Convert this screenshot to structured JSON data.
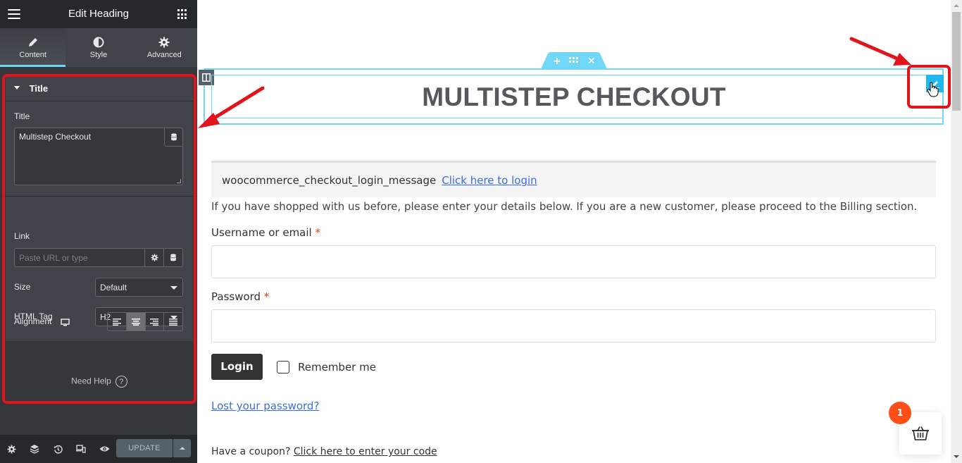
{
  "sidebar": {
    "header": {
      "title": "Edit Heading",
      "menu_icon": "hamburger-icon",
      "apps_icon": "grid-icon"
    },
    "tabs": [
      {
        "label": "Content",
        "icon": "pencil-icon",
        "active": true
      },
      {
        "label": "Style",
        "icon": "half-circle-icon",
        "active": false
      },
      {
        "label": "Advanced",
        "icon": "gear-icon",
        "active": false
      }
    ],
    "section": {
      "title": "Title",
      "fields": {
        "title_label": "Title",
        "title_value": "Multistep Checkout",
        "link_label": "Link",
        "link_placeholder": "Paste URL or type",
        "size_label": "Size",
        "size_value": "Default",
        "tag_label": "HTML Tag",
        "tag_value": "H2",
        "alignment_label": "Alignment",
        "alignment_options": [
          "left",
          "center",
          "right",
          "justify"
        ],
        "alignment_selected": "center"
      }
    },
    "help_label": "Need Help",
    "footer": {
      "update_label": "UPDATE",
      "icons": [
        "settings-icon",
        "layers-icon",
        "history-icon",
        "responsive-icon",
        "preview-icon"
      ]
    }
  },
  "canvas": {
    "heading": "MULTISTEP CHECKOUT",
    "notice": {
      "text": "woocommerce_checkout_login_message",
      "link": "Click here to login"
    },
    "intro": "If you have shopped with us before, please enter your details below. If you are a new customer, please proceed to the Billing section.",
    "username_label": "Username or email",
    "password_label": "Password",
    "required_mark": "*",
    "login_button": "Login",
    "remember_label": "Remember me",
    "lost_password": "Lost your password?",
    "coupon_text": "Have a coupon?",
    "coupon_link": "Click here to enter your code",
    "cart_count": "1"
  },
  "colors": {
    "accent": "#71d7f7",
    "edit_button": "#20b7ee",
    "annotation": "#e0141a",
    "link": "#3a6ee6",
    "badge": "#ff4e17"
  }
}
